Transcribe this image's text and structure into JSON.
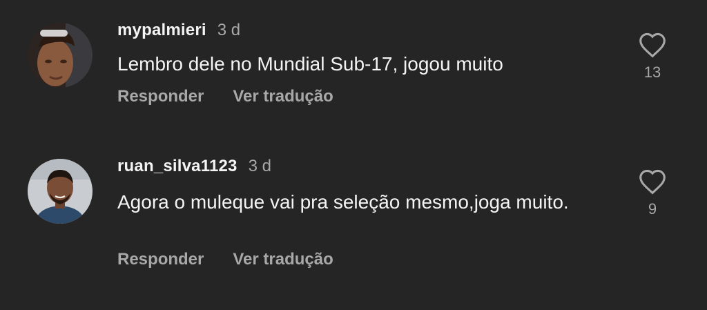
{
  "comments": [
    {
      "username": "mypalmieri",
      "time": "3 d",
      "text": "Lembro dele no Mundial Sub-17, jogou muito",
      "reply_label": "Responder",
      "translate_label": "Ver tradução",
      "likes": "13",
      "like_icon": "heart-outline-icon"
    },
    {
      "username": "ruan_silva1123",
      "time": "3 d",
      "text": "Agora o muleque vai pra seleção mesmo,joga muito.",
      "reply_label": "Responder",
      "translate_label": "Ver tradução",
      "likes": "9",
      "like_icon": "heart-outline-icon"
    }
  ],
  "colors": {
    "background": "#252525",
    "primary_text": "#f4f4f4",
    "secondary_text": "#a8a8a8"
  }
}
